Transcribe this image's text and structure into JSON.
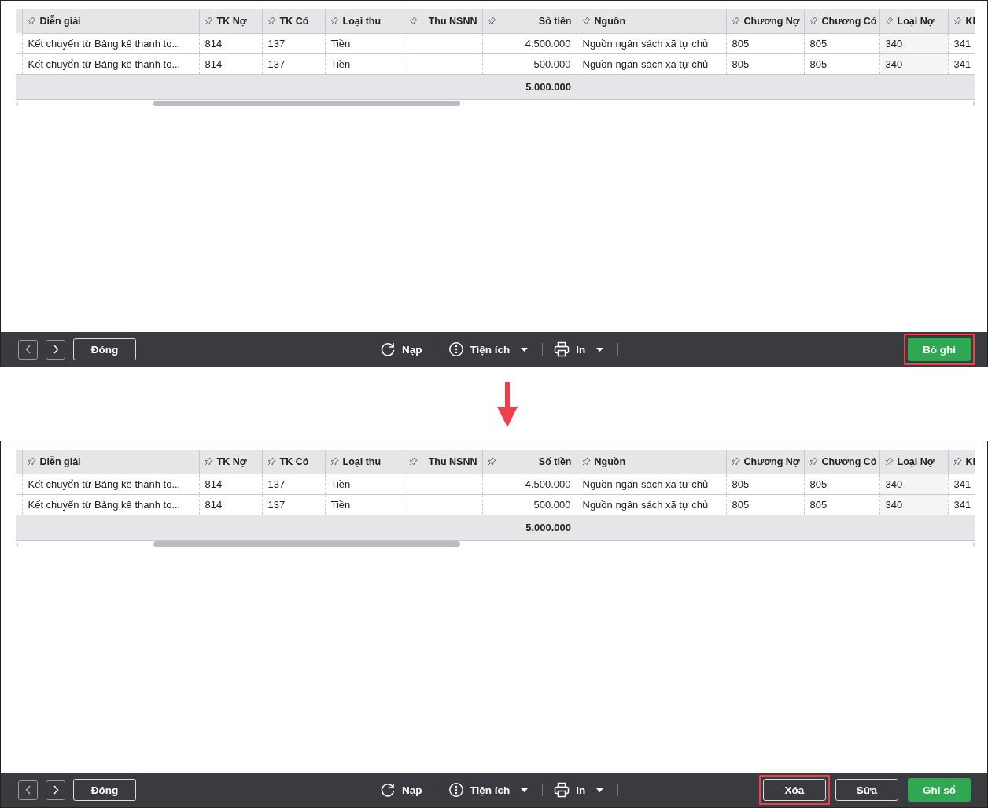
{
  "panels": [
    {
      "table": {
        "columns": [
          {
            "label": "Diễn giải",
            "kind": "text"
          },
          {
            "label": "TK Nợ",
            "kind": "text"
          },
          {
            "label": "TK Có",
            "kind": "text"
          },
          {
            "label": "Loại thu",
            "kind": "text"
          },
          {
            "label": "Thu NSNN",
            "kind": "number"
          },
          {
            "label": "Số tiền",
            "kind": "number",
            "total": "5.000.000"
          },
          {
            "label": "Nguồn",
            "kind": "text"
          },
          {
            "label": "Chương Nợ",
            "kind": "text"
          },
          {
            "label": "Chương Có",
            "kind": "text"
          },
          {
            "label": "Loại Nợ",
            "kind": "text"
          },
          {
            "label": "Kl",
            "kind": "text"
          }
        ],
        "rows": [
          [
            "Kết chuyển từ Bảng kê thanh to...",
            "814",
            "137",
            "Tiền",
            null,
            "4.500.000",
            "Nguồn ngân sách xã tự chủ",
            "805",
            "805",
            "340",
            "341"
          ],
          [
            "Kết chuyển từ Bảng kê thanh to...",
            "814",
            "137",
            "Tiền",
            null,
            "500.000",
            "Nguồn ngân sách xã tự chủ",
            "805",
            "805",
            "340",
            "341"
          ]
        ]
      },
      "toolbar": {
        "close_label": "Đóng",
        "tools": [
          {
            "kind": "refresh",
            "label": "Nạp",
            "dropdown": false
          },
          {
            "kind": "info",
            "label": "Tiện ích",
            "dropdown": true
          },
          {
            "kind": "print",
            "label": "In",
            "dropdown": true
          }
        ],
        "actions": [
          {
            "label": "Bỏ ghi",
            "kind": "primary",
            "highlighted": true
          }
        ]
      }
    },
    {
      "table": {
        "columns": [
          {
            "label": "Diễn giải",
            "kind": "text"
          },
          {
            "label": "TK Nợ",
            "kind": "text"
          },
          {
            "label": "TK Có",
            "kind": "text"
          },
          {
            "label": "Loại thu",
            "kind": "text"
          },
          {
            "label": "Thu NSNN",
            "kind": "number"
          },
          {
            "label": "Số tiền",
            "kind": "number",
            "total": "5.000.000"
          },
          {
            "label": "Nguồn",
            "kind": "text"
          },
          {
            "label": "Chương Nợ",
            "kind": "text"
          },
          {
            "label": "Chương Có",
            "kind": "text"
          },
          {
            "label": "Loại Nợ",
            "kind": "text"
          },
          {
            "label": "Kl",
            "kind": "text"
          }
        ],
        "rows": [
          [
            "Kết chuyển từ Bảng kê thanh to...",
            "814",
            "137",
            "Tiền",
            null,
            "4.500.000",
            "Nguồn ngân sách xã tự chủ",
            "805",
            "805",
            "340",
            "341"
          ],
          [
            "Kết chuyển từ Bảng kê thanh to...",
            "814",
            "137",
            "Tiền",
            null,
            "500.000",
            "Nguồn ngân sách xã tự chủ",
            "805",
            "805",
            "340",
            "341"
          ]
        ]
      },
      "toolbar": {
        "close_label": "Đóng",
        "tools": [
          {
            "kind": "refresh",
            "label": "Nạp",
            "dropdown": false
          },
          {
            "kind": "info",
            "label": "Tiện ích",
            "dropdown": true
          },
          {
            "kind": "print",
            "label": "In",
            "dropdown": true
          }
        ],
        "actions": [
          {
            "label": "Xóa",
            "kind": "outline",
            "highlighted": true
          },
          {
            "label": "Sửa",
            "kind": "outline",
            "highlighted": false
          },
          {
            "label": "Ghi sổ",
            "kind": "primary",
            "highlighted": false
          }
        ]
      }
    }
  ]
}
